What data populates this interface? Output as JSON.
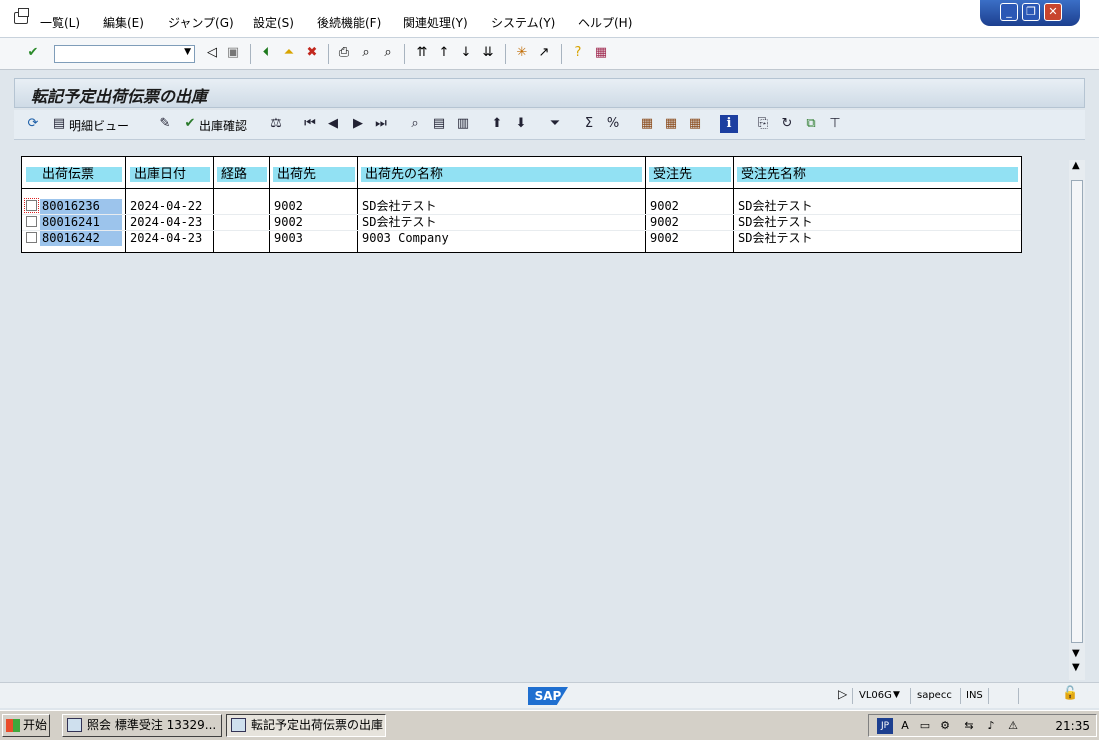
{
  "menu": {
    "items": [
      "一覧(L)",
      "編集(E)",
      "ジャンプ(G)",
      "設定(S)",
      "後続機能(F)",
      "関連処理(Y)",
      "システム(Y)",
      "ヘルプ(H)"
    ]
  },
  "window_controls": {
    "minimize": "_",
    "restore": "❐",
    "close": "✕"
  },
  "std_toolbar": {
    "command_field": "",
    "icons": [
      "enter-icon",
      "back-triangle-icon",
      "save-icon",
      "back-icon",
      "exit-icon",
      "cancel-icon",
      "print-icon",
      "find-icon",
      "find-next-icon",
      "first-page-icon",
      "previous-page-icon",
      "next-page-icon",
      "last-page-icon",
      "create-session-icon",
      "shortcut-icon",
      "help-icon",
      "layout-icon"
    ]
  },
  "screen": {
    "title": "転記予定出荷伝票の出庫"
  },
  "app_toolbar": {
    "detail_view_label": "明細ビュー",
    "goods_issue_label": "出庫確認"
  },
  "grid": {
    "headers": [
      "出荷伝票",
      "出庫日付",
      "経路",
      "出荷先",
      "出荷先の名称",
      "受注先",
      "受注先名称"
    ],
    "rows": [
      {
        "doc": "80016236",
        "date": "2024-04-22",
        "route": "",
        "ship_to": "9002",
        "ship_to_name": "SD会社テスト",
        "sold_to": "9002",
        "sold_to_name": "SD会社テスト"
      },
      {
        "doc": "80016241",
        "date": "2024-04-23",
        "route": "",
        "ship_to": "9002",
        "ship_to_name": "SD会社テスト",
        "sold_to": "9002",
        "sold_to_name": "SD会社テスト"
      },
      {
        "doc": "80016242",
        "date": "2024-04-23",
        "route": "",
        "ship_to": "9003",
        "ship_to_name": "9003 Company",
        "sold_to": "9002",
        "sold_to_name": "SD会社テスト"
      }
    ]
  },
  "status_bar": {
    "logo": "SAP",
    "transaction": "VL06G",
    "server": "sapecc",
    "mode": "INS"
  },
  "taskbar": {
    "start": "开始",
    "tasks": [
      "照会 標準受注 13329...",
      "転記予定出荷伝票の出庫"
    ],
    "ime": "JP",
    "clock": "21:35"
  }
}
